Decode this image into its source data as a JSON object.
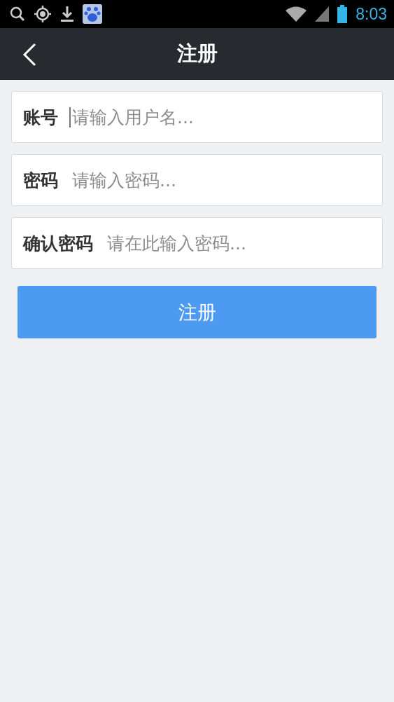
{
  "status_bar": {
    "time": "8:03"
  },
  "header": {
    "title": "注册"
  },
  "fields": [
    {
      "label": "账号",
      "placeholder": "请输入用户名...",
      "focused": true
    },
    {
      "label": "密码",
      "placeholder": "请输入密码...",
      "focused": false
    },
    {
      "label": "确认密码",
      "placeholder": "请在此输入密码...",
      "focused": false
    }
  ],
  "submit": {
    "label": "注册"
  }
}
